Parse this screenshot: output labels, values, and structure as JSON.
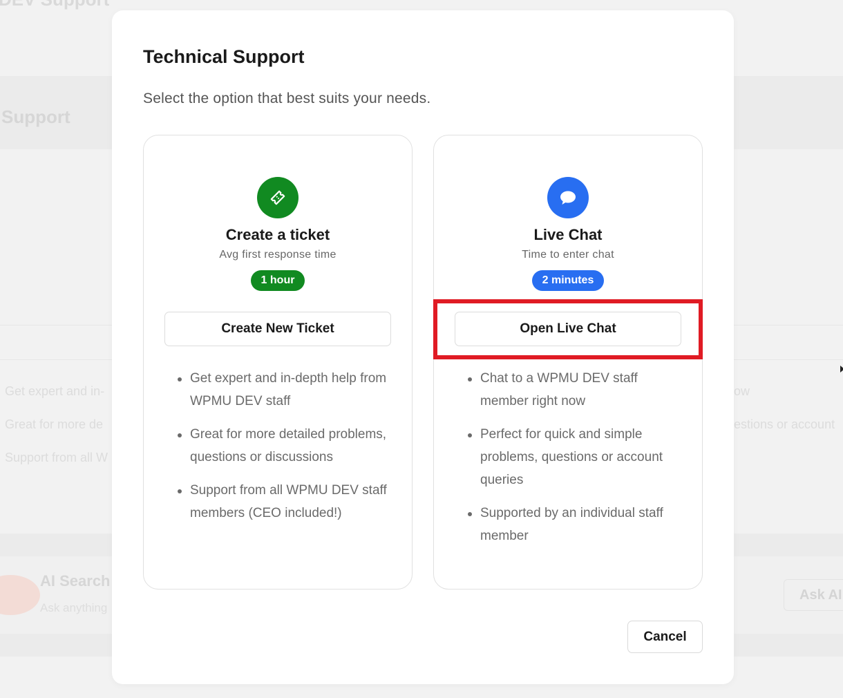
{
  "background": {
    "page_title": "DEV Support",
    "section_title": "Support",
    "feature_lines_left": [
      "Get expert and in-",
      "Great for more de",
      "Support from all W"
    ],
    "feature_lines_right": [
      "ow",
      "estions or account"
    ],
    "ai_search": {
      "title": "AI Search",
      "subtitle": "Ask anything",
      "button_label": "Ask AI"
    }
  },
  "modal": {
    "title": "Technical Support",
    "subtitle": "Select the option that best suits your needs.",
    "cancel_label": "Cancel",
    "options": [
      {
        "icon": "ticket-icon",
        "title": "Create a ticket",
        "subtitle": "Avg first response time",
        "badge": "1 hour",
        "badge_color": "#118a21",
        "button_label": "Create New Ticket",
        "features": [
          "Get expert and in-depth help from WPMU DEV staff",
          "Great for more detailed problems, questions or discussions",
          "Support from all WPMU DEV staff members (CEO included!)"
        ]
      },
      {
        "icon": "chat-bubble-icon",
        "title": "Live Chat",
        "subtitle": "Time to enter chat",
        "badge": "2 minutes",
        "badge_color": "#286ef1",
        "button_label": "Open Live Chat",
        "highlighted": true,
        "highlight_color": "#e01b24",
        "features": [
          "Chat to a WPMU DEV staff member right now",
          "Perfect for quick and simple problems, questions or account queries",
          "Supported by an individual staff member"
        ]
      }
    ]
  }
}
